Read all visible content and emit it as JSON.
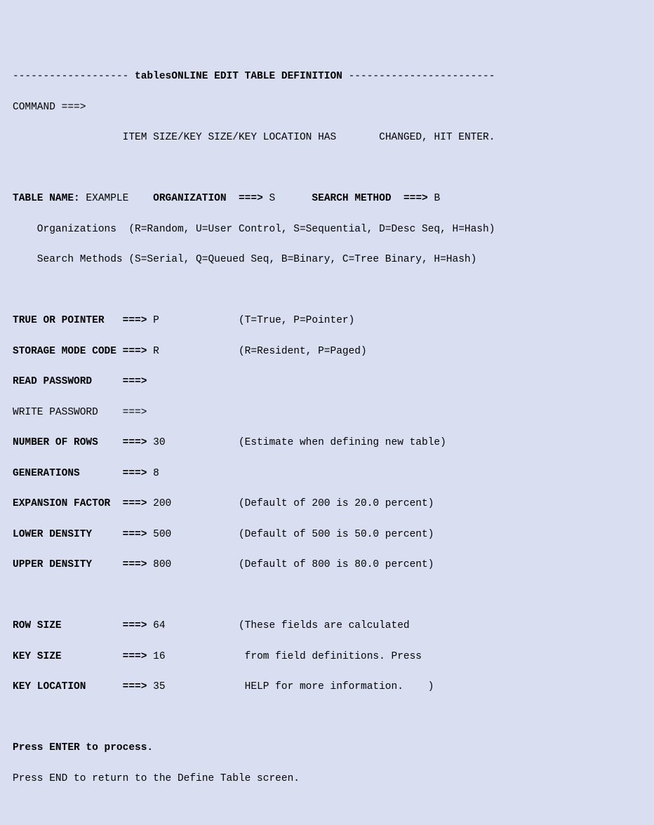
{
  "title_line": {
    "dash_left": "------------------- ",
    "title": "tablesONLINE EDIT TABLE DEFINITION",
    "dash_right": " ------------------------"
  },
  "command": {
    "label": "COMMAND ===>",
    "value": ""
  },
  "status_line": {
    "left": "ITEM SIZE/KEY SIZE/KEY LOCATION HAS",
    "right": "CHANGED, HIT ENTER."
  },
  "top_fields": {
    "table_name_label": "TABLE NAME:",
    "table_name_value": "EXAMPLE",
    "organization_label": "ORGANIZATION  ===>",
    "organization_value": "S",
    "search_method_label": "SEARCH METHOD  ===>",
    "search_method_value": "B"
  },
  "legend": {
    "organizations": "    Organizations  (R=Random, U=User Control, S=Sequential, D=Desc Seq, H=Hash)",
    "search_methods": "    Search Methods (S=Serial, Q=Queued Seq, B=Binary, C=Tree Binary, H=Hash)"
  },
  "fields": {
    "true_or_pointer": {
      "label": "TRUE OR POINTER   ===>",
      "value": "P",
      "hint": "(T=True, P=Pointer)"
    },
    "storage_mode": {
      "label": "STORAGE MODE CODE ===>",
      "value": "R",
      "hint": "(R=Resident, P=Paged)"
    },
    "read_password": {
      "label": "READ PASSWORD     ===>",
      "value": "",
      "hint": ""
    },
    "write_password": {
      "label": "WRITE PASSWORD    ===>",
      "value": "",
      "hint": ""
    },
    "number_of_rows": {
      "label": "NUMBER OF ROWS    ===>",
      "value": "30",
      "hint": "(Estimate when defining new table)"
    },
    "generations": {
      "label": "GENERATIONS       ===>",
      "value": "8",
      "hint": ""
    },
    "expansion_factor": {
      "label": "EXPANSION FACTOR  ===>",
      "value": "200",
      "hint": "(Default of 200 is 20.0 percent)"
    },
    "lower_density": {
      "label": "LOWER DENSITY     ===>",
      "value": "500",
      "hint": "(Default of 500 is 50.0 percent)"
    },
    "upper_density": {
      "label": "UPPER DENSITY     ===>",
      "value": "800",
      "hint": "(Default of 800 is 80.0 percent)"
    },
    "row_size": {
      "label": "ROW SIZE          ===>",
      "value": "64",
      "hint": "(These fields are calculated"
    },
    "key_size": {
      "label": "KEY SIZE          ===>",
      "value": "16",
      "hint": " from field definitions. Press"
    },
    "key_location": {
      "label": "KEY LOCATION      ===>",
      "value": "35",
      "hint": " HELP for more information.    )"
    }
  },
  "footer": {
    "line1": "Press ENTER to process.",
    "line2": "Press END to return to the Define Table screen."
  }
}
